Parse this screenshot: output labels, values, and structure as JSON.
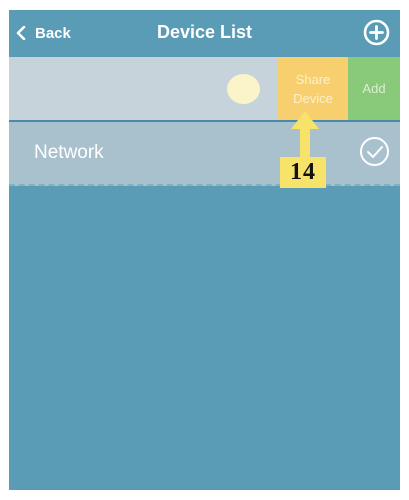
{
  "header": {
    "back_label": "Back",
    "title": "Device List",
    "add_icon": "plus-circle-icon"
  },
  "device_row": {
    "toggle_icon": "toggle-knob",
    "share_line1": "Share",
    "share_line2": "Device",
    "add_label": "Add"
  },
  "network_row": {
    "label": "Network",
    "status_icon": "check-circle-icon"
  },
  "annotation": {
    "step_number": "14"
  },
  "colors": {
    "header_bg": "#5a9bb5",
    "share_bg": "#f8cf6e",
    "add_bg": "#88c97a",
    "annotation_bg": "#f7e36a"
  }
}
